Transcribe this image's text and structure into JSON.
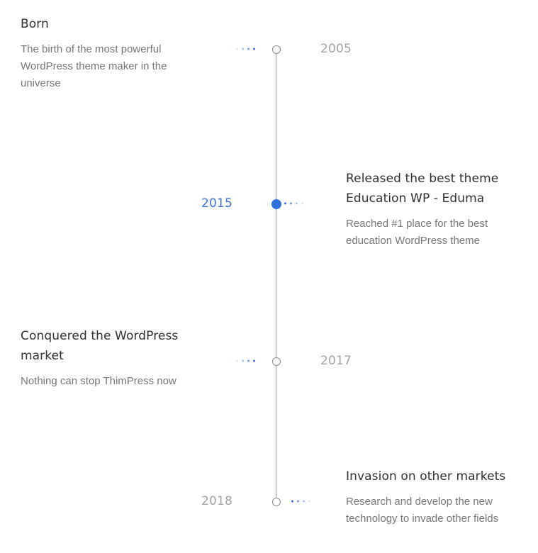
{
  "colors": {
    "accent": "#2f6fe0",
    "line": "#9a9a9a",
    "year_muted": "#a3a3a3",
    "title": "#303030",
    "text": "#777777"
  },
  "timeline": {
    "events": [
      {
        "year": "2005",
        "title": "Born",
        "description": "The birth of the most powerful WordPress theme maker in the universe",
        "active": false
      },
      {
        "year": "2015",
        "title": "Released the best theme Education WP - Eduma",
        "description": "Reached #1 place for the best education WordPress theme",
        "active": true
      },
      {
        "year": "2017",
        "title": "Conquered the WordPress market",
        "description": "Nothing can stop ThimPress now",
        "active": false
      },
      {
        "year": "2018",
        "title": "Invasion on other markets",
        "description": "Research and develop the new technology to invade other fields",
        "active": false
      }
    ]
  }
}
